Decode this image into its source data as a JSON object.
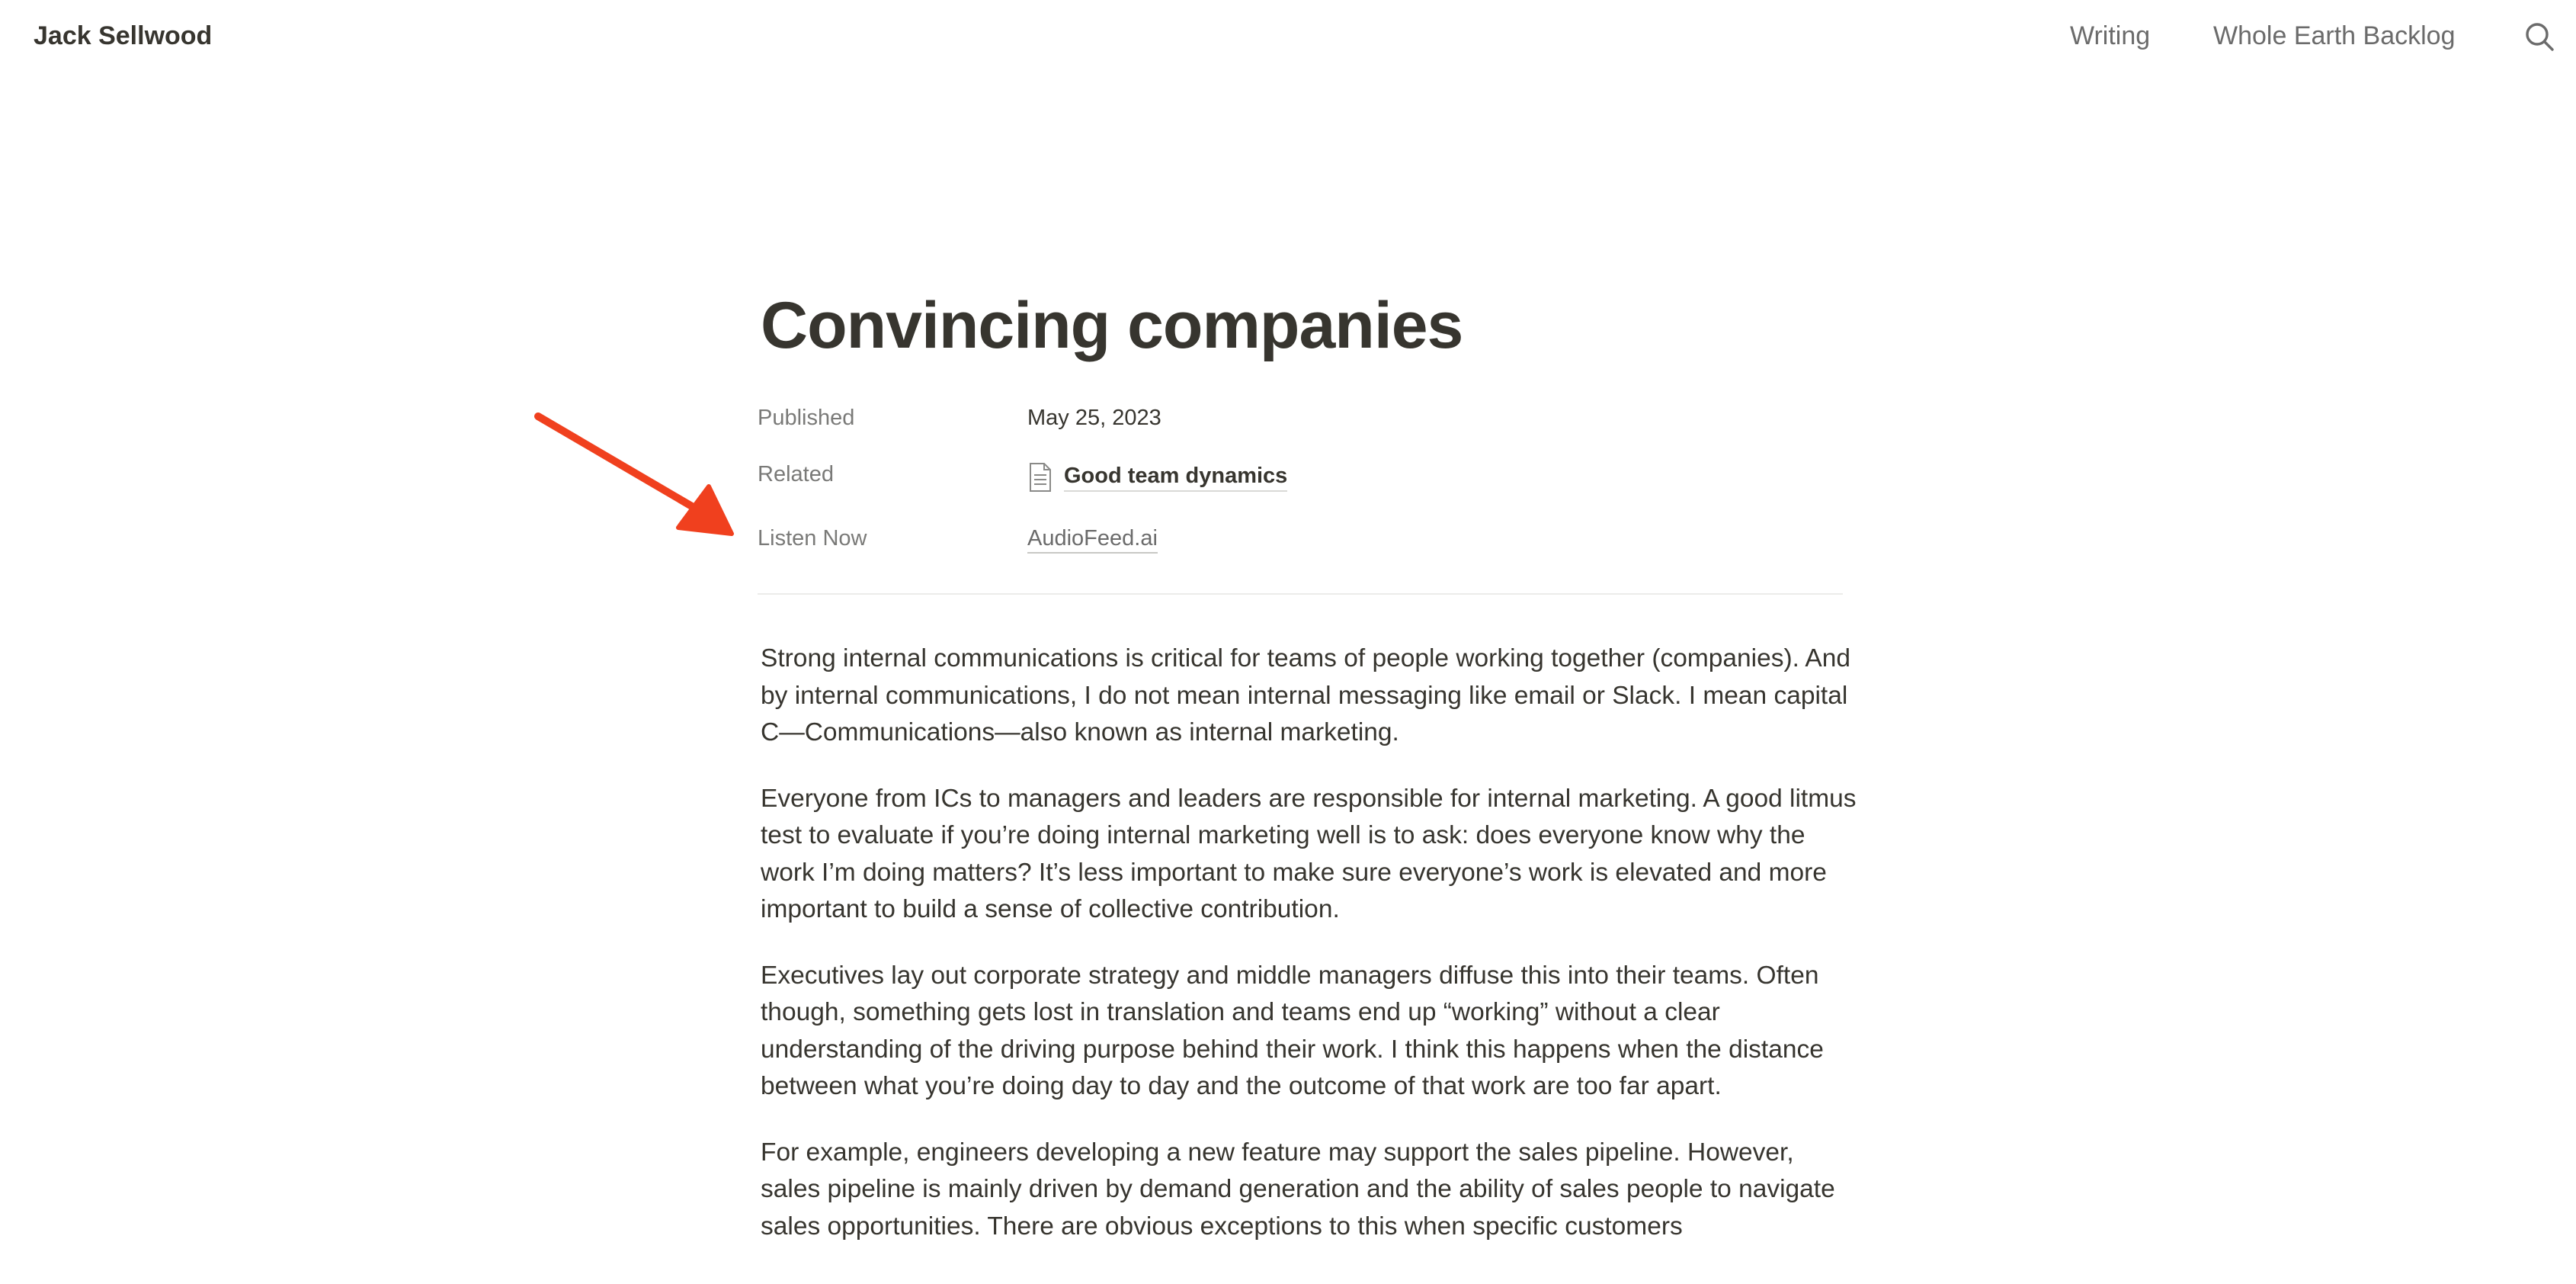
{
  "header": {
    "site_name": "Jack Sellwood",
    "nav": [
      {
        "label": "Writing"
      },
      {
        "label": "Whole Earth Backlog"
      }
    ],
    "search_icon": "search-icon"
  },
  "page": {
    "title": "Convincing companies",
    "properties": {
      "published": {
        "label": "Published",
        "value": "May 25, 2023"
      },
      "related": {
        "label": "Related",
        "value": "Good team dynamics",
        "icon": "document-icon"
      },
      "listen": {
        "label": "Listen Now",
        "value": "AudioFeed.ai"
      }
    }
  },
  "annotation": {
    "arrow_color": "#f0401e",
    "icon": "red-arrow-annotation"
  },
  "article": {
    "paragraphs": [
      "Strong internal communications is critical for teams of people working together (companies). And by internal communications, I do not mean internal messaging like email or Slack. I mean capital C—Communications—also known as internal marketing.",
      "Everyone from ICs to managers and leaders are responsible for internal marketing. A good litmus test to evaluate if you’re doing internal marketing well is to ask: does everyone know why the work I’m doing matters? It’s less important to make sure everyone’s work is elevated and more important to build a sense of collective contribution.",
      "Executives lay out corporate strategy and middle managers diffuse this into their teams. Often though, something gets lost in translation and teams end up “working” without a clear understanding of the driving purpose behind their work. I think this happens when the distance between what you’re doing day to day and the outcome of that work are too far apart.",
      "For example, engineers developing a new feature may support the sales pipeline. However, sales pipeline is mainly driven by demand generation and the ability of sales people to navigate sales opportunities. There are obvious exceptions to this when specific customers"
    ]
  }
}
